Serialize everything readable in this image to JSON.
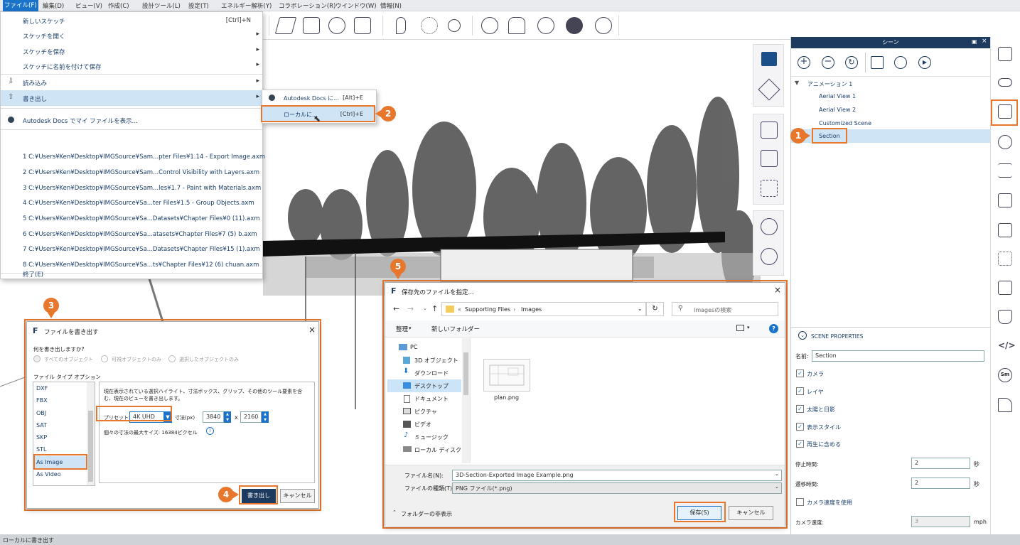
{
  "menubar": [
    "ファイル(F)",
    "編集(D)",
    "ビュー(V)",
    "作成(C)",
    "設計ツール(L)",
    "設定(T)",
    "エネルギー解析(Y)",
    "コラボレーション(R)",
    "ウインドウ(W)",
    "情報(N)"
  ],
  "file_menu": {
    "new": {
      "label": "新しいスケッチ",
      "shortcut": "[Ctrl]+N"
    },
    "open": "スケッチを開く",
    "save": "スケッチを保存",
    "save_as": "スケッチに名前を付けて保存",
    "import": "読み込み",
    "export": "書き出し",
    "docs": "Autodesk Docs でマイ ファイルを表示...",
    "recent": [
      "1 C:¥Users¥Ken¥Desktop¥IMGSource¥Sam...pter Files¥1.14 - Export Image.axm",
      "2 C:¥Users¥Ken¥Desktop¥IMGSource¥Sam...Control Visibility with Layers.axm",
      "3 C:¥Users¥Ken¥Desktop¥IMGSource¥Sam...les¥1.7 - Paint with Materials.axm",
      "4 C:¥Users¥Ken¥Desktop¥IMGSource¥Sa...ter Files¥1.5 - Group Objects.axm",
      "5 C:¥Users¥Ken¥Desktop¥IMGSource¥Sa...Datasets¥Chapter Files¥0 (11).axm",
      "6 C:¥Users¥Ken¥Desktop¥IMGSource¥Sa...atasets¥Chapter Files¥7 (5) b.axm",
      "7 C:¥Users¥Ken¥Desktop¥IMGSource¥Sa...Datasets¥Chapter Files¥15 (1).axm",
      "8 C:¥Users¥Ken¥Desktop¥IMGSource¥Sa...ts¥Chapter Files¥12 (6) chuan.axm"
    ],
    "exit": "終了(E)"
  },
  "submenu": {
    "docs": {
      "label": "Autodesk Docs に...",
      "shortcut": "[Alt]+E"
    },
    "local": {
      "label": "ローカルに...",
      "shortcut": "[Ctrl]+E"
    }
  },
  "callouts": [
    "1",
    "2",
    "3",
    "4",
    "5"
  ],
  "scene_panel": {
    "title": "シーン",
    "animation": "アニメーション 1",
    "scenes": [
      "Aerial View 1",
      "Aerial View 2",
      "Customized Scene",
      "Section"
    ],
    "props_title": "SCENE PROPERTIES",
    "name_label": "名前:",
    "name_value": "Section",
    "checks": [
      "カメラ",
      "レイヤ",
      "太陽と日影",
      "表示スタイル",
      "再生に含める"
    ],
    "stop_label": "停止時間:",
    "stop_value": "2",
    "trans_label": "遷移時間:",
    "trans_value": "2",
    "sec": "秒",
    "camspeed_check": "カメラ速度を使用",
    "camspeed_label": "カメラ速度:",
    "camspeed_value": "3",
    "mph": "mph"
  },
  "export_dialog": {
    "title": "ファイルを書き出す",
    "question": "何を書き出しますか?",
    "radio": [
      "すべてのオブジェクト",
      "可視オブジェクトのみ",
      "選択したオブジェクトのみ"
    ],
    "type_label": "ファイル タイプ オプション",
    "types": [
      "DXF",
      "FBX",
      "OBJ",
      "SAT",
      "SKP",
      "STL",
      "As Image",
      "As Video"
    ],
    "desc": "現在表示されている選択ハイライト、寸法ボックス、グリップ、その他のツール要素を含む、現在のビューを書き出します。",
    "preset_label": "プリセット:",
    "preset_value": "4K UHD",
    "size_label": "寸法(px)",
    "width": "3840",
    "x": "x",
    "height": "2160",
    "max": "個々の寸法の最大サイズ: 16384ピクセル",
    "export_btn": "書き出し",
    "cancel_btn": "キャンセル"
  },
  "save_dialog": {
    "title": "保存先のファイルを指定...",
    "path": [
      "Supporting Files",
      "Images"
    ],
    "search": "Imagesの検索",
    "organize": "整理",
    "new_folder": "新しいフォルダー",
    "tree": [
      "PC",
      "3D オブジェクト",
      "ダウンロード",
      "デスクトップ",
      "ドキュメント",
      "ピクチャ",
      "ビデオ",
      "ミュージック",
      "ローカル ディスク (C"
    ],
    "file": "plan.png",
    "filename_label": "ファイル名(N):",
    "filename": "3D-Section-Exported Image Example.png",
    "filetype_label": "ファイルの種類(T):",
    "filetype": "PNG ファイル(*.png)",
    "hide_folders": "フォルダーの非表示",
    "save_btn": "保存(S)",
    "cancel_btn": "キャンセル"
  },
  "status": "ローカルに書き出す",
  "colors": {
    "accent": "#e8772e",
    "selection": "#cfe4f4"
  }
}
